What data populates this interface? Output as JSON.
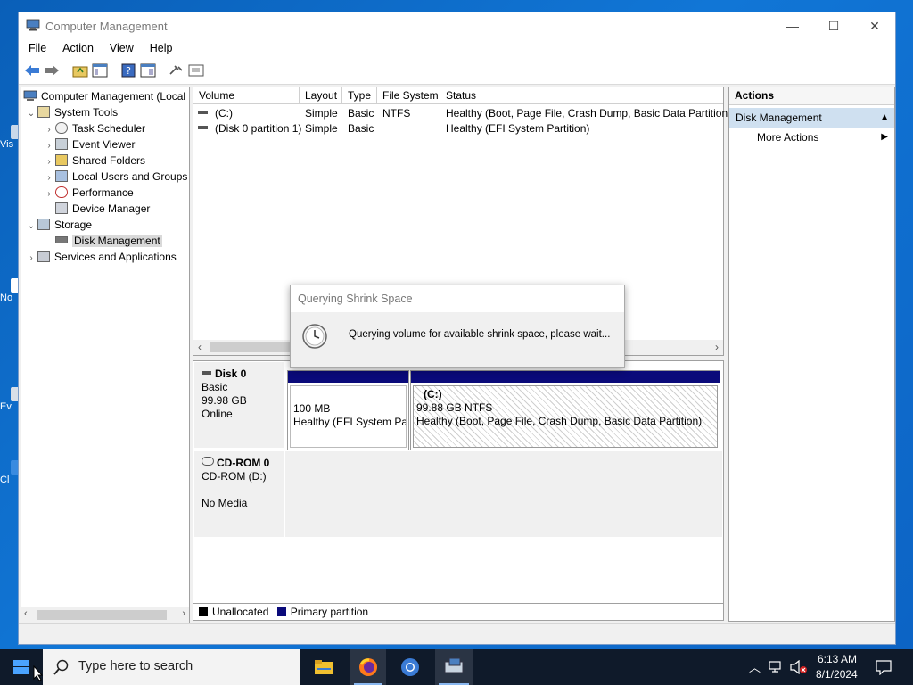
{
  "window": {
    "title": "Computer Management",
    "controls": [
      "—",
      "☐",
      "✕"
    ]
  },
  "menu": [
    "File",
    "Action",
    "View",
    "Help"
  ],
  "tree": {
    "root": "Computer Management (Local",
    "system_tools": "System Tools",
    "items": [
      "Task Scheduler",
      "Event Viewer",
      "Shared Folders",
      "Local Users and Groups",
      "Performance",
      "Device Manager"
    ],
    "storage": "Storage",
    "disk_management": "Disk Management",
    "services": "Services and Applications"
  },
  "volume_list": {
    "columns": [
      "Volume",
      "Layout",
      "Type",
      "File System",
      "Status"
    ],
    "rows": [
      [
        "(C:)",
        "Simple",
        "Basic",
        "NTFS",
        "Healthy (Boot, Page File, Crash Dump, Basic Data Partition)"
      ],
      [
        "(Disk 0 partition 1)",
        "Simple",
        "Basic",
        "",
        "Healthy (EFI System Partition)"
      ]
    ]
  },
  "disks": {
    "disk0": {
      "name": "Disk 0",
      "type": "Basic",
      "size": "99.98 GB",
      "state": "Online",
      "p1": {
        "size": "100 MB",
        "status": "Healthy (EFI System Par"
      },
      "p2": {
        "name": "(C:)",
        "size": "99.88 GB NTFS",
        "status": "Healthy (Boot, Page File, Crash Dump, Basic Data Partition)"
      }
    },
    "cdrom": {
      "name": "CD-ROM 0",
      "drive": "CD-ROM (D:)",
      "media": "No Media"
    }
  },
  "legend": {
    "unallocated": "Unallocated",
    "primary": "Primary partition"
  },
  "actions": {
    "header": "Actions",
    "section": "Disk Management",
    "more": "More Actions"
  },
  "dialog": {
    "title": "Querying Shrink Space",
    "message": "Querying volume for available shrink space, please wait..."
  },
  "taskbar": {
    "search_placeholder": "Type here to search",
    "time": "6:13 AM",
    "date": "8/1/2024"
  },
  "desktop_fragments": [
    "Vis",
    "No",
    "Ev",
    "Cl"
  ],
  "colors": {
    "primary_partition": "#0a0a7a",
    "selection": "#cfe0f0",
    "accent": "#0078d7"
  }
}
